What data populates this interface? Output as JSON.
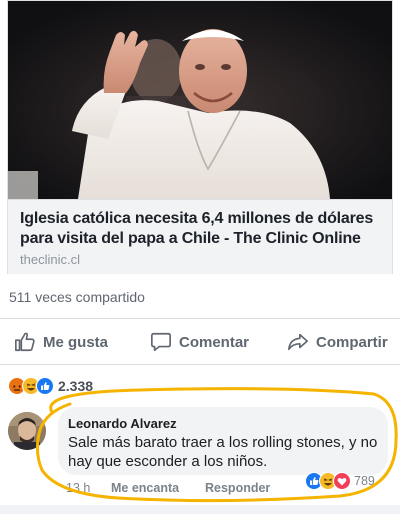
{
  "post": {
    "link_title": "Iglesia católica necesita 6,4 millones de dólares para visita del papa a Chile - The Clinic Online",
    "link_domain": "theclinic.cl",
    "shares": "511 veces compartido"
  },
  "actions": {
    "like": "Me gusta",
    "comment": "Comentar",
    "share": "Compartir",
    "like_icon": "thumbs-up-icon",
    "comment_icon": "speech-bubble-icon",
    "share_icon": "share-arrow-icon"
  },
  "reactions": {
    "count": "2.338",
    "types": [
      "angry",
      "haha",
      "like"
    ]
  },
  "comment": {
    "author": "Leonardo Alvarez",
    "text": "Sale más barato traer a los rolling stones, y no hay que esconder a los niños.",
    "time": "13 h",
    "like_label": "Me encanta",
    "reply_label": "Responder",
    "reaction_count": "789",
    "reaction_types": [
      "like",
      "haha",
      "love"
    ]
  },
  "colors": {
    "like_blue": "#1877f2",
    "love_red": "#f33e58",
    "haha_yellow": "#f7b928",
    "angry_orange": "#e9710f",
    "annotation_circle": "#f4b400",
    "muted_text": "#606770"
  }
}
